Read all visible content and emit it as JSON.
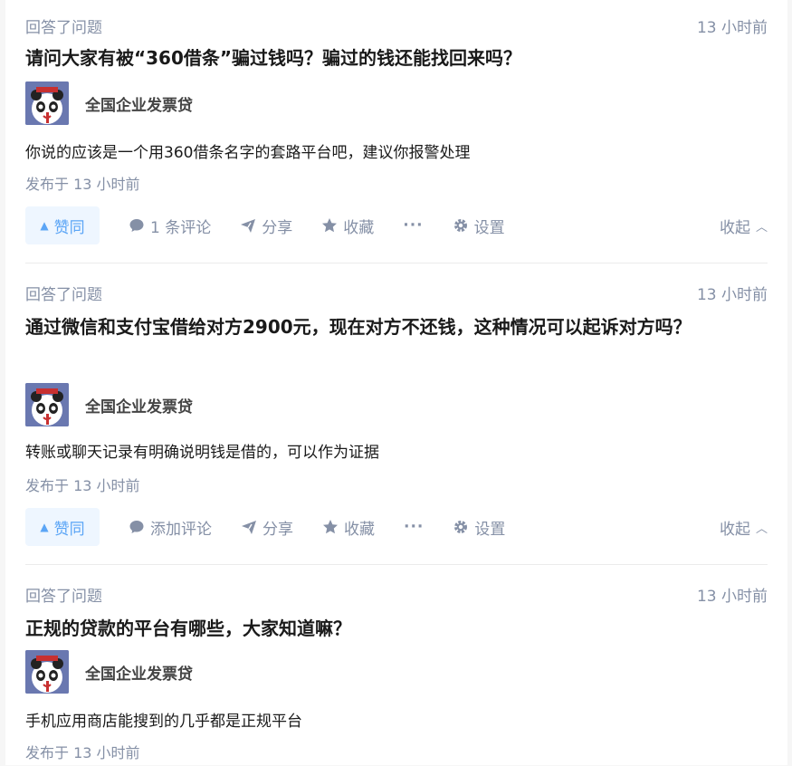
{
  "items": [
    {
      "meta": "回答了问题",
      "time": "13 小时前",
      "question": "请问大家有被“360借条”骗过钱吗？骗过的钱还能找回来吗？",
      "author": "全国企业发票贷",
      "answer": "你说的应该是一个用360借条名字的套路平台吧，建议你报警处理",
      "published": "发布于 13 小时前",
      "actions": {
        "vote": "赞同",
        "comment": "1 条评论",
        "share": "分享",
        "favorite": "收藏",
        "more": "···",
        "settings": "设置",
        "collapse": "收起"
      }
    },
    {
      "meta": "回答了问题",
      "time": "13 小时前",
      "question": "通过微信和支付宝借给对方2900元，现在对方不还钱，这种情况可以起诉对方吗？",
      "author": "全国企业发票贷",
      "answer": "转账或聊天记录有明确说明钱是借的，可以作为证据",
      "published": "发布于 13 小时前",
      "actions": {
        "vote": "赞同",
        "comment": "添加评论",
        "share": "分享",
        "favorite": "收藏",
        "more": "···",
        "settings": "设置",
        "collapse": "收起"
      }
    },
    {
      "meta": "回答了问题",
      "time": "13 小时前",
      "question": "正规的贷款的平台有哪些，大家知道嘛？",
      "author": "全国企业发票贷",
      "answer": "手机应用商店能搜到的几乎都是正规平台",
      "published": "发布于 13 小时前"
    }
  ],
  "colors": {
    "meta": "#8590a6",
    "vote_bg": "#eef6ff",
    "vote_text": "#5ba5f6",
    "title": "#1a1a1a"
  }
}
